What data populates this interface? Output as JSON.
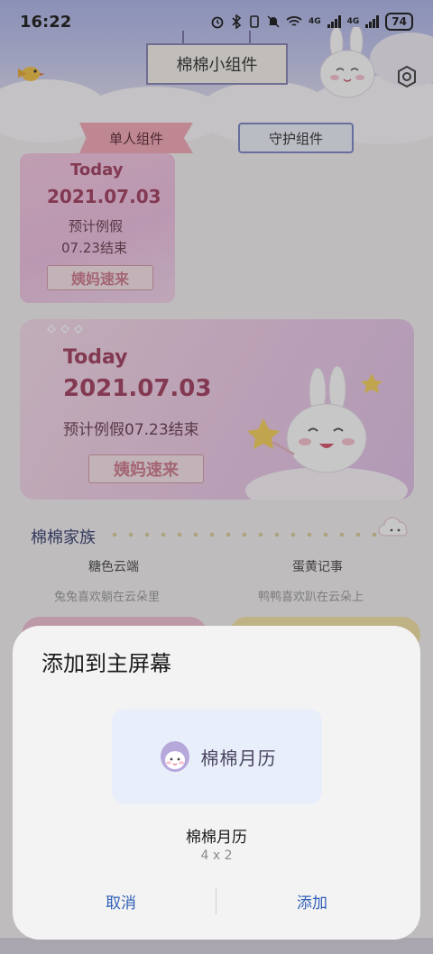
{
  "status_bar": {
    "time": "16:22",
    "network_1": "4G",
    "network_2": "4G",
    "battery": "74"
  },
  "header": {
    "title": "棉棉小组件",
    "settings_icon": "gear-icon"
  },
  "tabs": [
    {
      "label": "单人组件",
      "active": true
    },
    {
      "label": "守护组件",
      "active": false
    }
  ],
  "widget_small": {
    "today": "Today",
    "date": "2021.07.03",
    "line1": "预计例假",
    "line2": "07.23结束",
    "banner": "姨妈速来"
  },
  "widget_large": {
    "today": "Today",
    "date": "2021.07.03",
    "line1": "预计例假07.23结束",
    "banner": "姨妈速来"
  },
  "family": {
    "title": "棉棉家族",
    "members": [
      {
        "name": "糖色云端",
        "desc": "兔兔喜欢躺在云朵里"
      },
      {
        "name": "蛋黄记事",
        "desc": "鸭鸭喜欢趴在云朵上"
      }
    ]
  },
  "dialog": {
    "title": "添加到主屏幕",
    "preview_label": "棉棉月历",
    "widget_name": "棉棉月历",
    "widget_size": "4 x 2",
    "cancel": "取消",
    "add": "添加"
  },
  "colors": {
    "accent_button": "#2f5fb8",
    "tab_active": "#f3a9b8",
    "card_text": "#a34060"
  }
}
